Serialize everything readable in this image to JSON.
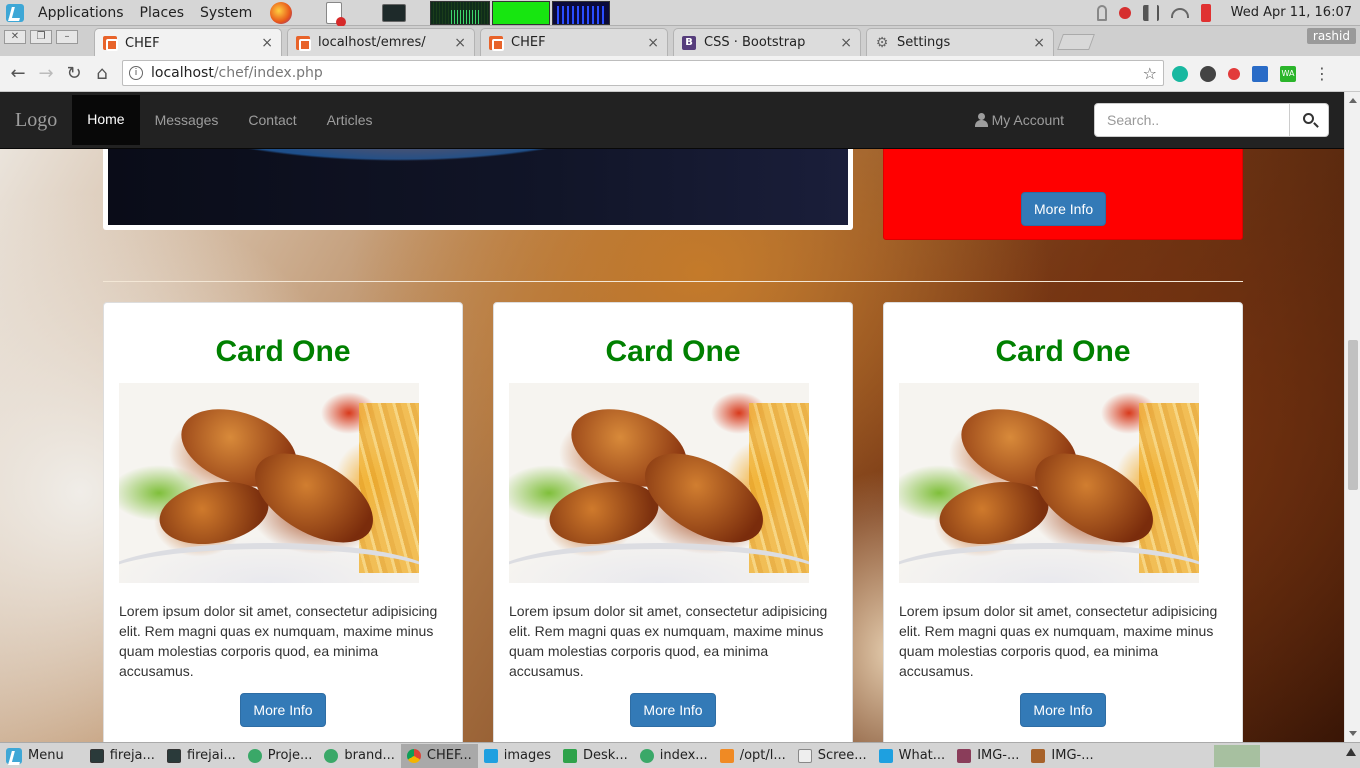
{
  "top_panel": {
    "menus": [
      "Applications",
      "Places",
      "System"
    ],
    "clock": "Wed Apr 11, 16:07"
  },
  "browser": {
    "tabs": [
      {
        "label": "CHEF",
        "icon": "html5-icon"
      },
      {
        "label": "localhost/emres/",
        "icon": "html5-icon"
      },
      {
        "label": "CHEF",
        "icon": "html5-icon"
      },
      {
        "label": "CSS · Bootstrap",
        "icon": "bootstrap-icon"
      },
      {
        "label": "Settings",
        "icon": "gear-icon"
      }
    ],
    "bootstrap_letter": "B",
    "profile": "rashid",
    "url_host": "localhost",
    "url_path": "/chef/index.php",
    "ext_wa": "WA"
  },
  "page": {
    "navbar": {
      "brand": "Logo",
      "links": [
        "Home",
        "Messages",
        "Contact",
        "Articles"
      ],
      "account": "My Account",
      "search_placeholder": "Search.."
    },
    "red_panel": {
      "button": "More Info"
    },
    "cards": [
      {
        "title": "Card One",
        "text": "Lorem ipsum dolor sit amet, consectetur adipisicing elit. Rem magni quas ex numquam, maxime minus quam molestias corporis quod, ea minima accusamus.",
        "button": "More Info"
      },
      {
        "title": "Card One",
        "text": "Lorem ipsum dolor sit amet, consectetur adipisicing elit. Rem magni quas ex numquam, maxime minus quam molestias corporis quod, ea minima accusamus.",
        "button": "More Info"
      },
      {
        "title": "Card One",
        "text": "Lorem ipsum dolor sit amet, consectetur adipisicing elit. Rem magni quas ex numquam, maxime minus quam molestias corporis quod, ea minima accusamus.",
        "button": "More Info"
      }
    ],
    "colors": {
      "card_title": "#008000",
      "panel": "#ff0000",
      "button": "#337ab7",
      "navbar": "#222222"
    }
  },
  "taskbar": {
    "menu": "Menu",
    "items": [
      {
        "label": "fireja...",
        "icon": "terminal-icon"
      },
      {
        "label": "firejai...",
        "icon": "terminal-icon"
      },
      {
        "label": "Proje...",
        "icon": "app-icon"
      },
      {
        "label": "brand...",
        "icon": "app-icon"
      },
      {
        "label": "CHEF...",
        "icon": "chrome-icon"
      },
      {
        "label": "images",
        "icon": "folder-icon"
      },
      {
        "label": "Desk...",
        "icon": "spreadsheet-icon"
      },
      {
        "label": "index...",
        "icon": "app-icon"
      },
      {
        "label": "/opt/l...",
        "icon": "sublime-icon"
      },
      {
        "label": "Scree...",
        "icon": "screenshot-icon"
      },
      {
        "label": "What...",
        "icon": "folder-icon"
      },
      {
        "label": "IMG-...",
        "icon": "image-icon"
      },
      {
        "label": "IMG-...",
        "icon": "image-icon"
      }
    ]
  }
}
